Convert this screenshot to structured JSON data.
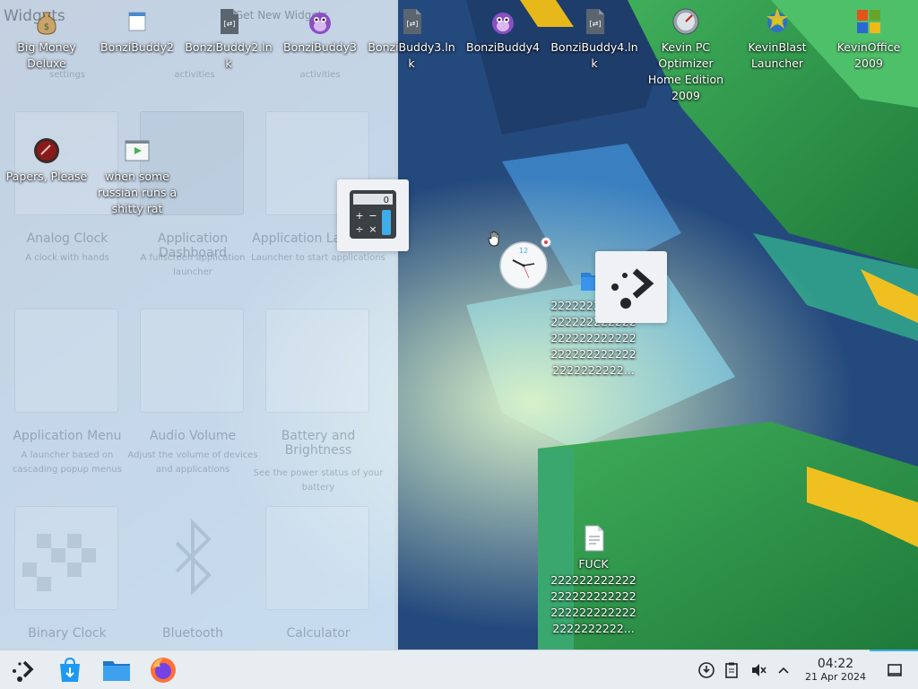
{
  "window_title": "Widgets",
  "panel": {
    "title": "Widgets",
    "search_hint": "Get New Widgets",
    "top_descs": [
      "settings",
      "activities",
      "activities"
    ],
    "widgets": [
      {
        "name": "Analog Clock",
        "desc": "A clock with hands"
      },
      {
        "name": "Application Dashboard",
        "desc": "A fullscreen application launcher"
      },
      {
        "name": "Application Launcher",
        "desc": "Launcher to start applications"
      },
      {
        "name": "Application Menu",
        "desc": "A launcher based on cascading popup menus"
      },
      {
        "name": "Audio Volume",
        "desc": "Adjust the volume of devices and applications"
      },
      {
        "name": "Battery and Brightness",
        "desc": "See the power status of your battery"
      },
      {
        "name": "Binary Clock",
        "desc": ""
      },
      {
        "name": "Bluetooth",
        "desc": ""
      },
      {
        "name": "Calculator",
        "desc": ""
      }
    ]
  },
  "desktop": {
    "icons": [
      {
        "label": "Big Money Deluxe",
        "icon": "money-bag-icon"
      },
      {
        "label": "BonziBuddy2",
        "icon": "window-app-icon"
      },
      {
        "label": "BonziBuddy2.lnk",
        "icon": "shortcut-file-icon"
      },
      {
        "label": "BonziBuddy3",
        "icon": "bonzi-gorilla-icon"
      },
      {
        "label": "BonziBuddy3.lnk",
        "icon": "shortcut-file-icon"
      },
      {
        "label": "BonziBuddy4",
        "icon": "bonzi-gorilla-icon"
      },
      {
        "label": "BonziBuddy4.lnk",
        "icon": "shortcut-file-icon"
      },
      {
        "label": "Kevin PC Optimizer Home Edition 2009",
        "icon": "gauge-icon"
      },
      {
        "label": "KevinBlast Launcher",
        "icon": "globe-star-icon"
      },
      {
        "label": "KevinOffice 2009",
        "icon": "office-logo-icon"
      },
      {
        "label": "Papers, Please",
        "icon": "red-disc-icon"
      },
      {
        "label": "when some russian runs a shitty rat",
        "icon": "video-file-icon"
      },
      {
        "label": "2222222222222222222222222222222222222222222222222222222222...",
        "icon": "folder-icon"
      },
      {
        "label": "FUCK 2222222222222222222222222222222222222222222222...",
        "icon": "text-file-icon"
      }
    ]
  },
  "applets": {
    "calculator": {
      "display": "0"
    },
    "clock": {
      "number": "12"
    }
  },
  "taskbar": {
    "time": "04:22",
    "date": "21 Apr 2024"
  },
  "colors": {
    "accent": "#3daee9",
    "taskbar_bg": "#e8edf2",
    "folder_blue": "#2e7fd6"
  }
}
